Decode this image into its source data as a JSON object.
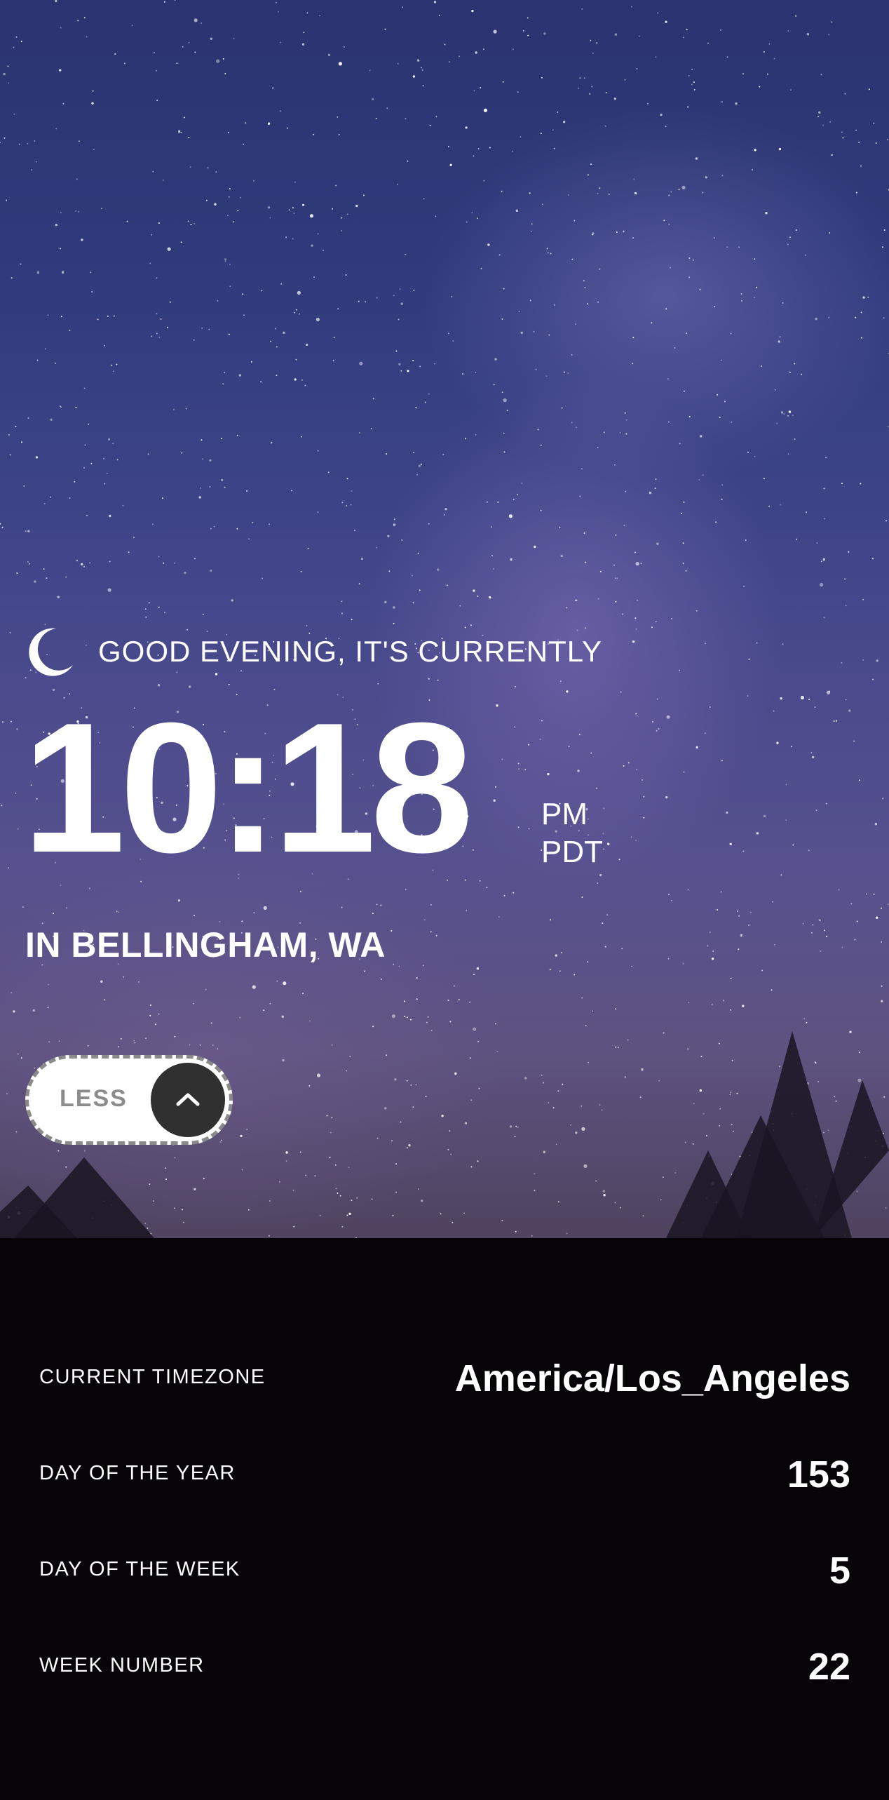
{
  "greeting": {
    "icon": "moon-icon",
    "text": "GOOD EVENING, IT'S CURRENTLY"
  },
  "clock": {
    "time": "10:18",
    "meridiem": "PM",
    "timezone_abbr": "PDT"
  },
  "location": "IN BELLINGHAM, WA",
  "toggle": {
    "label": "LESS",
    "icon": "chevron-up-icon"
  },
  "details": [
    {
      "label": "CURRENT TIMEZONE",
      "value": "America/Los_Angeles"
    },
    {
      "label": "DAY OF THE YEAR",
      "value": "153"
    },
    {
      "label": "DAY OF THE WEEK",
      "value": "5"
    },
    {
      "label": "WEEK NUMBER",
      "value": "22"
    }
  ],
  "colors": {
    "sky_top": "#2b3470",
    "sky_bottom": "#4f435f",
    "panel_background": "#060406",
    "toggle_background": "#ffffff",
    "toggle_knob": "#303030",
    "toggle_label": "#8c8c8c",
    "text": "#ffffff"
  }
}
